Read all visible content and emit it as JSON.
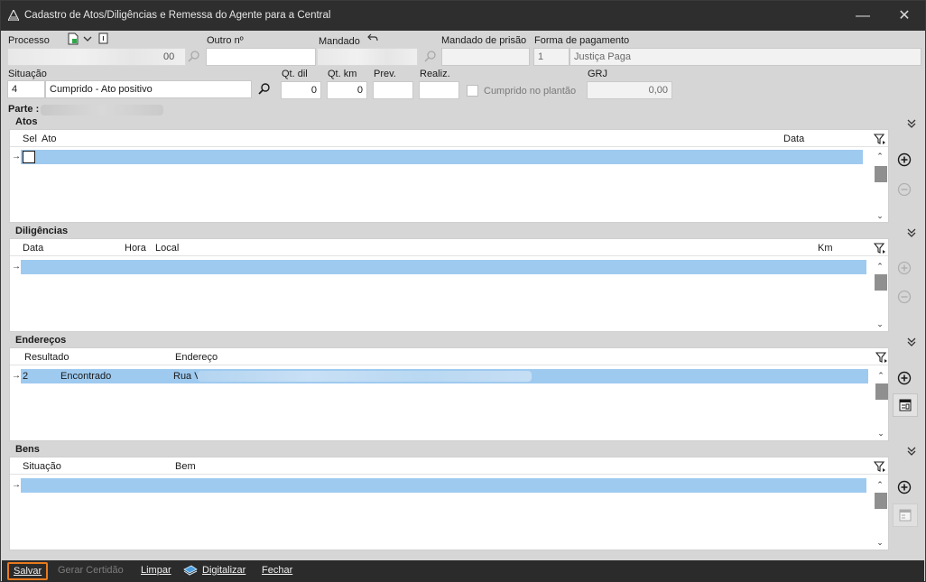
{
  "window": {
    "title": "Cadastro de Atos/Diligências e Remessa do Agente para a Central",
    "minimize_glyph": "—",
    "close_glyph": "✕"
  },
  "form": {
    "processo_label": "Processo",
    "processo_suffix": "00",
    "outro_label": "Outro nº",
    "outro_value": "",
    "mandado_label": "Mandado",
    "mandado_prisao_label": "Mandado de prisão",
    "mandado_prisao_value": "",
    "forma_pagamento_label": "Forma de pagamento",
    "forma_pagamento_code": "1",
    "forma_pagamento_value": "Justiça Paga",
    "situacao_label": "Situação",
    "situacao_code": "4",
    "situacao_value": "Cumprido - Ato positivo",
    "qt_dil_label": "Qt. dil",
    "qt_dil_value": "0",
    "qt_km_label": "Qt. km",
    "qt_km_value": "0",
    "prev_label": "Prev.",
    "prev_value": "",
    "realiz_label": "Realiz.",
    "realiz_value": "",
    "cumprido_plantao_label": "Cumprido no plantão",
    "grj_label": "GRJ",
    "grj_value": "0,00",
    "parte_label": "Parte :"
  },
  "sections": {
    "atos": {
      "title": "Atos",
      "columns": {
        "sel": "Sel",
        "ato": "Ato",
        "data": "Data"
      }
    },
    "diligencias": {
      "title": "Diligências",
      "columns": {
        "data": "Data",
        "hora": "Hora",
        "local": "Local",
        "km": "Km"
      }
    },
    "enderecos": {
      "title": "Endereços",
      "columns": {
        "resultado": "Resultado",
        "endereco": "Endereço"
      },
      "rows": [
        {
          "num": "2",
          "resultado": "Encontrado",
          "endereco": "Rua V"
        }
      ]
    },
    "bens": {
      "title": "Bens",
      "columns": {
        "situacao": "Situação",
        "bem": "Bem"
      }
    }
  },
  "footer": {
    "salvar": "Salvar",
    "gerar_certidao": "Gerar Certidão",
    "limpar": "Limpar",
    "digitalizar": "Digitalizar",
    "fechar": "Fechar"
  },
  "colors": {
    "titlebar": "#2e2e2e",
    "selection": "#9ecaf0",
    "focus_outline": "#e87a1e"
  }
}
